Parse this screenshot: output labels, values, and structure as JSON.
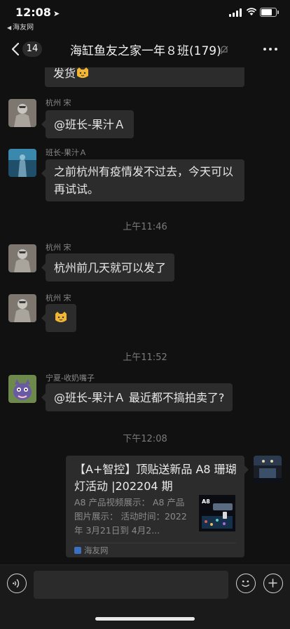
{
  "status": {
    "time": "12:08",
    "back_app": "海友网"
  },
  "nav": {
    "unread_count": "14",
    "title": "海缸鱼友之家一年８班(179)"
  },
  "messages": [
    {
      "type": "text",
      "text": "发货"
    },
    {
      "type": "text",
      "sender": "杭州 宋",
      "text": "@班长-果汁Ａ"
    },
    {
      "type": "text",
      "sender": "班长-果汁Ａ",
      "text": "之前杭州有疫情发不过去，今天可以再试试。"
    },
    {
      "type": "time",
      "text": "上午11:46"
    },
    {
      "type": "text",
      "sender": "杭州 宋",
      "text": "杭州前几天就可以发了"
    },
    {
      "type": "emoji",
      "sender": "杭州 宋"
    },
    {
      "type": "time",
      "text": "上午11:52"
    },
    {
      "type": "text",
      "sender": "宁夏-收奶嘴子",
      "text": "@班长-果汁Ａ 最近都不搞拍卖了?"
    },
    {
      "type": "time",
      "text": "下午12:08"
    },
    {
      "type": "link",
      "title": "【A+智控】顶贴送新品 A8 珊瑚灯活动 |202204 期",
      "description": "A8 产品视频展示： A8 产品图片展示： 活动时间：2022 年 3月21日到 4月2...",
      "thumb_label": "A8",
      "source": "海友网"
    }
  ],
  "input": {
    "placeholder": ""
  }
}
